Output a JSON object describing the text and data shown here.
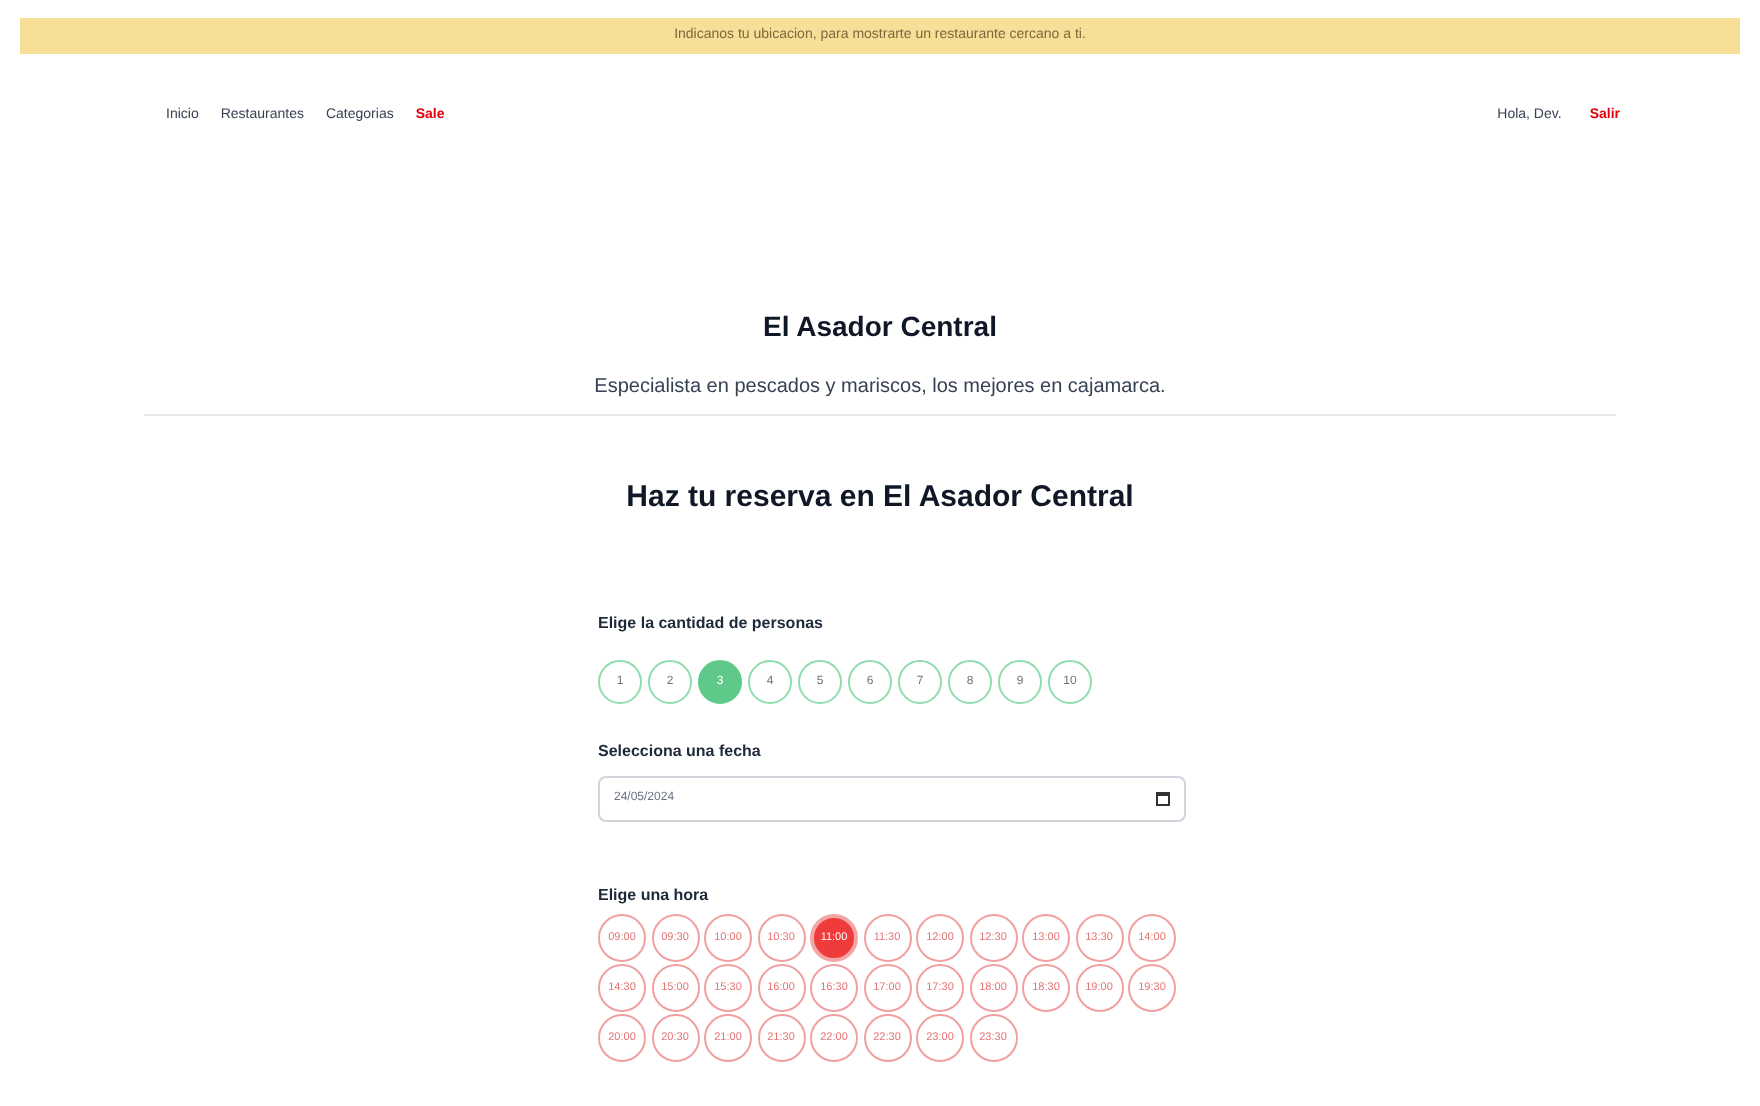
{
  "banner": "Indicanos tu ubicacion, para mostrarte un restaurante cercano a ti.",
  "nav": {
    "links": [
      {
        "label": "Inicio",
        "kind": "plain"
      },
      {
        "label": "Restaurantes",
        "kind": "plain"
      },
      {
        "label": "Categorias",
        "kind": "plain"
      },
      {
        "label": "Sale",
        "kind": "accent"
      }
    ],
    "greeting": "Hola, Dev.",
    "logout": "Salir"
  },
  "restaurant": {
    "name": "El Asador Central",
    "description": "Especialista en pescados y mariscos, los mejores en cajamarca."
  },
  "reservation": {
    "heading": "Haz tu reserva en El Asador Central",
    "people_label": "Elige la cantidad de personas",
    "people": [
      {
        "label": "1",
        "selected": false
      },
      {
        "label": "2",
        "selected": false
      },
      {
        "label": "3",
        "selected": true
      },
      {
        "label": "4",
        "selected": false
      },
      {
        "label": "5",
        "selected": false
      },
      {
        "label": "6",
        "selected": false
      },
      {
        "label": "7",
        "selected": false
      },
      {
        "label": "8",
        "selected": false
      },
      {
        "label": "9",
        "selected": false
      },
      {
        "label": "10",
        "selected": false
      }
    ],
    "date_label": "Selecciona una fecha",
    "date_value": "24/05/2024",
    "time_label": "Elige una hora",
    "times": [
      {
        "label": "09:00",
        "selected": false
      },
      {
        "label": "09:30",
        "selected": false
      },
      {
        "label": "10:00",
        "selected": false
      },
      {
        "label": "10:30",
        "selected": false
      },
      {
        "label": "11:00",
        "selected": true
      },
      {
        "label": "11:30",
        "selected": false
      },
      {
        "label": "12:00",
        "selected": false
      },
      {
        "label": "12:30",
        "selected": false
      },
      {
        "label": "13:00",
        "selected": false
      },
      {
        "label": "13:30",
        "selected": false
      },
      {
        "label": "14:00",
        "selected": false
      },
      {
        "label": "14:30",
        "selected": false
      },
      {
        "label": "15:00",
        "selected": false
      },
      {
        "label": "15:30",
        "selected": false
      },
      {
        "label": "16:00",
        "selected": false
      },
      {
        "label": "16:30",
        "selected": false
      },
      {
        "label": "17:00",
        "selected": false
      },
      {
        "label": "17:30",
        "selected": false
      },
      {
        "label": "18:00",
        "selected": false
      },
      {
        "label": "18:30",
        "selected": false
      },
      {
        "label": "19:00",
        "selected": false
      },
      {
        "label": "19:30",
        "selected": false
      },
      {
        "label": "20:00",
        "selected": false
      },
      {
        "label": "20:30",
        "selected": false
      },
      {
        "label": "21:00",
        "selected": false
      },
      {
        "label": "21:30",
        "selected": false
      },
      {
        "label": "22:00",
        "selected": false
      },
      {
        "label": "22:30",
        "selected": false
      },
      {
        "label": "23:00",
        "selected": false
      },
      {
        "label": "23:30",
        "selected": false
      }
    ]
  }
}
